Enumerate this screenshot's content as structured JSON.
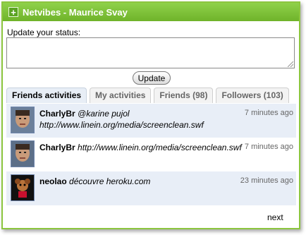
{
  "widget": {
    "title": "Netvibes - Maurice Svay",
    "add_icon": "plus-icon"
  },
  "status": {
    "label": "Update your status:",
    "value": "",
    "button_label": "Update"
  },
  "tabs": [
    {
      "label": "Friends activities",
      "active": true
    },
    {
      "label": "My activities",
      "active": false
    },
    {
      "label": "Friends (98)",
      "active": false
    },
    {
      "label": "Followers (103)",
      "active": false
    }
  ],
  "activities": [
    {
      "user": "CharlyBr",
      "text": "@karine pujol",
      "line2": "http://www.linein.org/media/screenclean.swf",
      "time": "7 minutes ago"
    },
    {
      "user": "CharlyBr",
      "text": "http://www.linein.org/media/screenclean.swf",
      "line2": "",
      "time": "7 minutes ago"
    },
    {
      "user": "neolao",
      "text": "découvre heroku.com",
      "line2": "",
      "time": "23 minutes ago"
    }
  ],
  "pager": {
    "next_label": "next"
  },
  "colors": {
    "accent": "#76b72f",
    "row_alt": "#e8eef7"
  }
}
